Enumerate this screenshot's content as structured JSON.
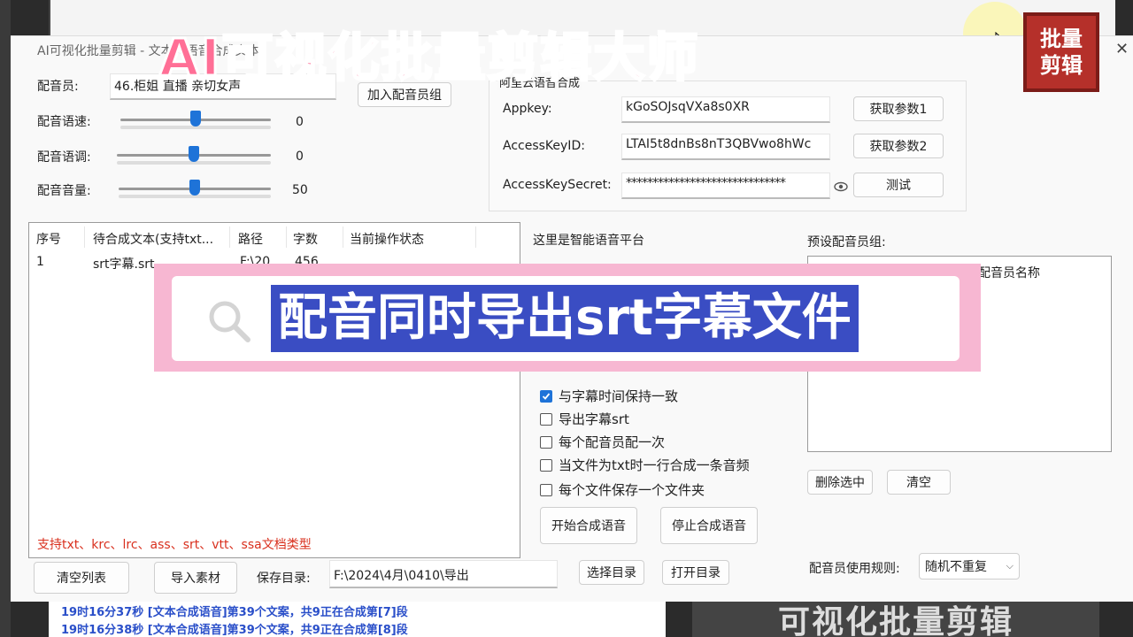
{
  "window": {
    "title": "AI可视化批量剪辑 - 文本转语音合成文本"
  },
  "overlay": {
    "title": "AI可视化批量剪辑大师",
    "seal_line1": "批量",
    "seal_line2": "剪辑",
    "banner": "配音同时导出srt字幕文件",
    "bottom_bg_text": "可视化批量剪辑"
  },
  "voice": {
    "voice_label": "配音员:",
    "voice_value": "46.柜姐 直播 亲切女声",
    "add_group_button": "加入配音员组",
    "speed_label": "配音语速:",
    "speed_value": "0",
    "speed_level": 0.5,
    "pitch_label": "配音语调:",
    "pitch_value": "0",
    "pitch_level": 0.5,
    "volume_label": "配音音量:",
    "volume_value": "50",
    "volume_level": 0.5
  },
  "aliyun": {
    "group_title": "阿里云语音合成",
    "appkey_label": "Appkey:",
    "appkey_value": "kGoSOJsqVXa8s0XR",
    "get_param1_button": "获取参数1",
    "accesskeyid_label": "AccessKeyID:",
    "accesskeyid_value": "LTAI5t8dnBs8nT3QBVwo8hWc",
    "get_param2_button": "获取参数2",
    "secret_label": "AccessKeySecret:",
    "secret_value": "******************************",
    "test_button": "测试"
  },
  "table": {
    "headers": [
      "序号",
      "待合成文本(支持txt...",
      "路径",
      "字数",
      "当前操作状态"
    ],
    "rows": [
      {
        "index": "1",
        "text": "srt字幕.srt",
        "path": "F:\\20",
        "count": "456",
        "status": ""
      }
    ]
  },
  "platform_label": "这里是智能语音平台",
  "options": {
    "keep_sync": {
      "label": "与字幕时间保持一致",
      "checked": true
    },
    "export_srt": {
      "label": "导出字幕srt",
      "checked": false
    },
    "each_voice": {
      "label": "每个配音员配一次",
      "checked": false
    },
    "txt_line": {
      "label": "当文件为txt时一行合成一条音频",
      "checked": false
    },
    "folder_each": {
      "label": "每个文件保存一个文件夹",
      "checked": false
    }
  },
  "actions": {
    "start_button": "开始合成语音",
    "stop_button": "停止合成语音"
  },
  "preset": {
    "label": "预设配音员组:",
    "column_header": "配音员名称",
    "delete_button": "删除选中",
    "clear_button": "清空",
    "rule_label": "配音员使用规则:",
    "rule_value": "随机不重复"
  },
  "bottom": {
    "hint": "支持txt、krc、lrc、ass、srt、vtt、ssa文档类型",
    "clear_list_button": "清空列表",
    "import_button": "导入素材",
    "save_dir_label": "保存目录:",
    "save_dir_value": "F:\\2024\\4月\\0410\\导出",
    "choose_dir_button": "选择目录",
    "open_dir_button": "打开目录"
  },
  "log": [
    "19时16分37秒  [文本合成语音]第39个文案，共9正在合成第[7]段",
    "19时16分38秒  [文本合成语音]第39个文案，共9正在合成第[8]段"
  ],
  "colors": {
    "accent": "#1e73d8",
    "hint_red": "#d9301e",
    "log_blue": "#2a4fc9",
    "banner_pink": "#f7b7d2",
    "banner_blue": "#3a4dc3",
    "title_pink": "#ff6f96",
    "seal_red": "#b5302a"
  }
}
